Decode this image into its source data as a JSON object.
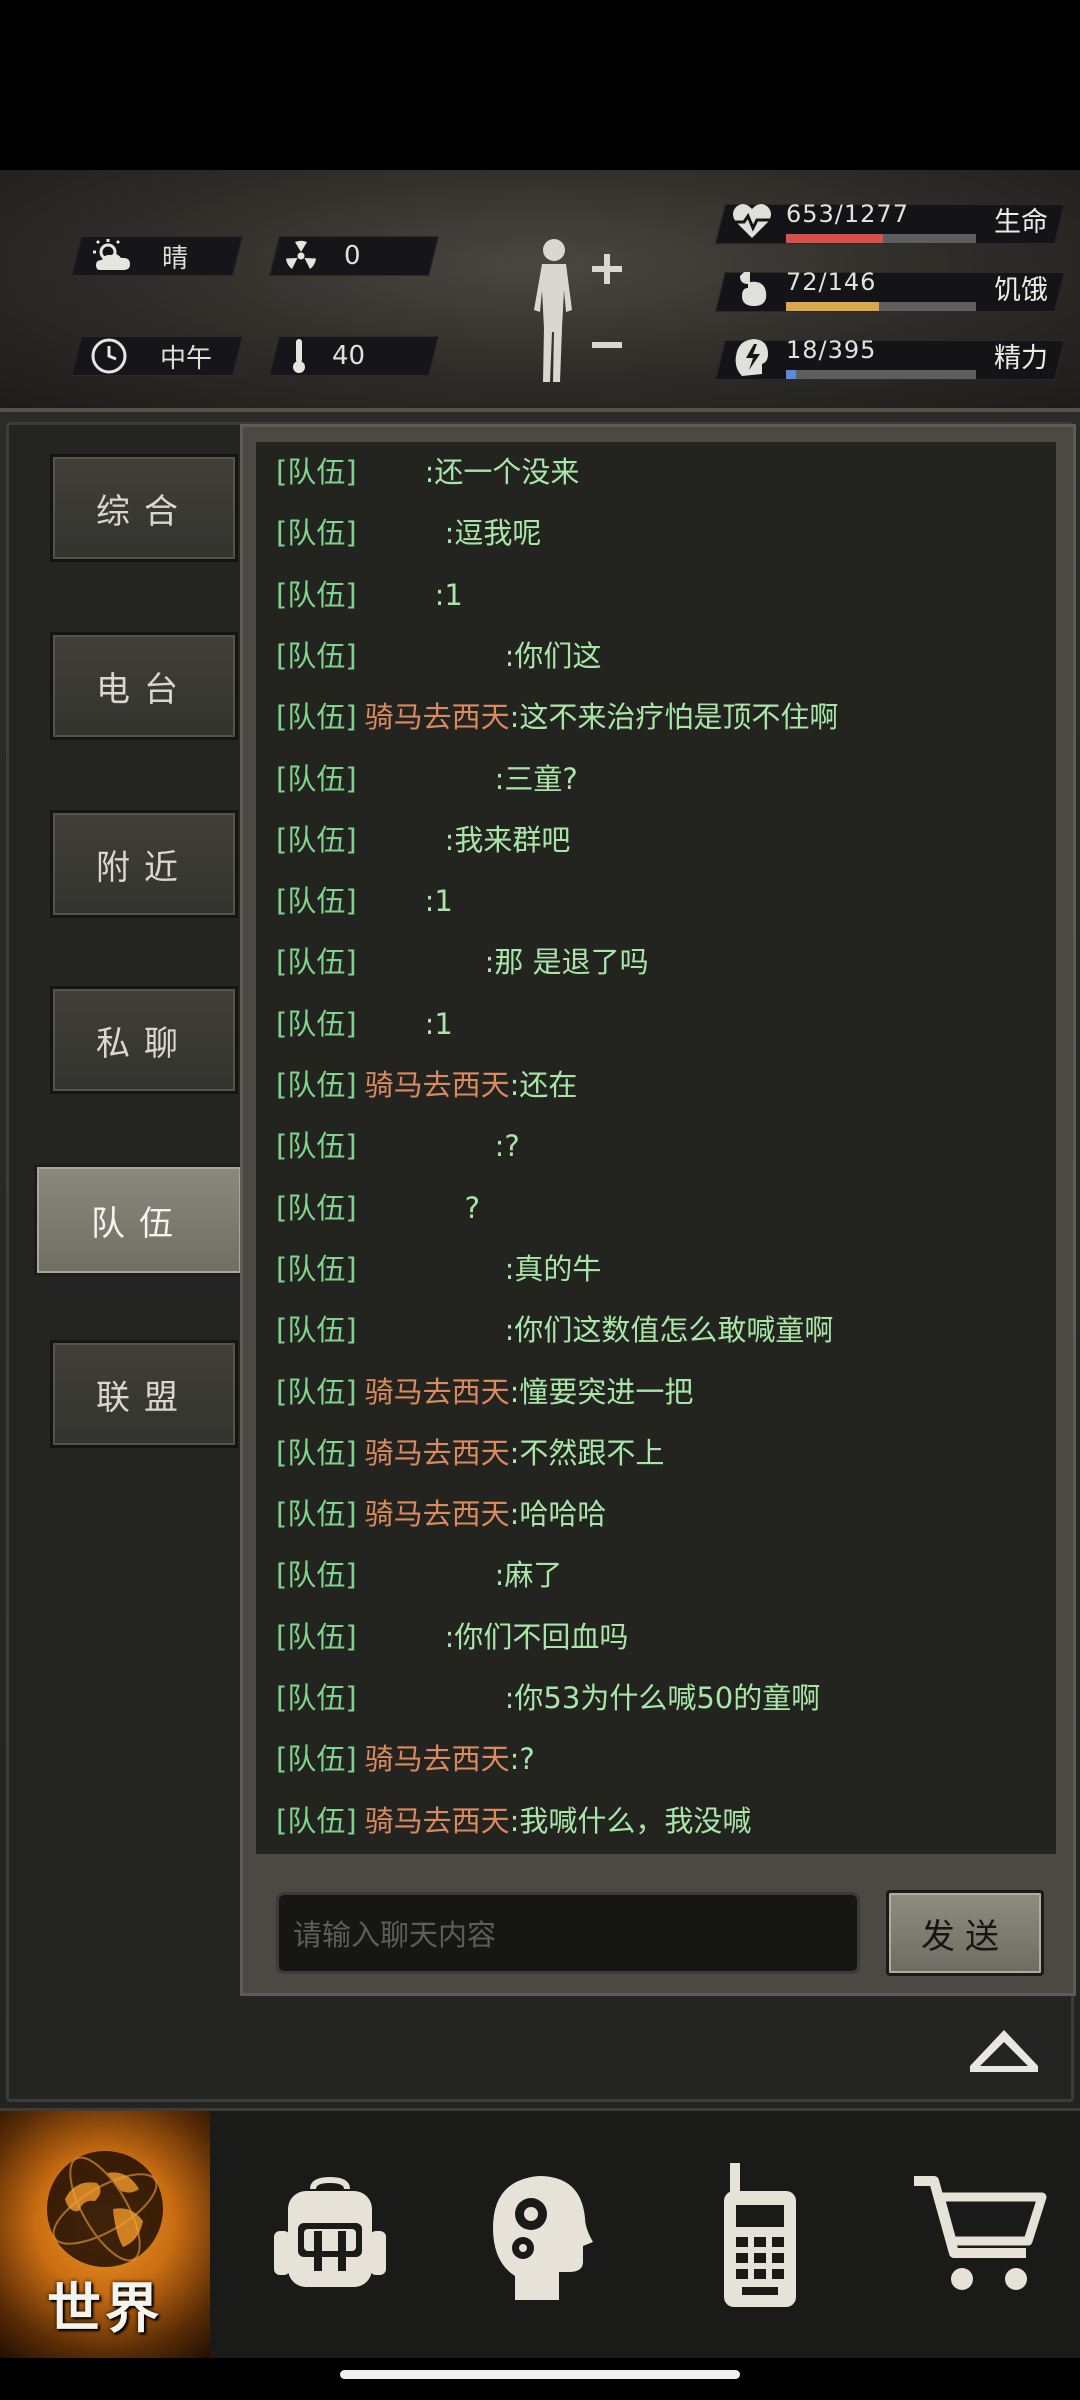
{
  "hud": {
    "weather": "晴",
    "radiation": "0",
    "time_of_day": "中午",
    "temperature": "40",
    "stats": {
      "hp": {
        "value": "653/1277",
        "label": "生命",
        "fraction": 0.51,
        "color": "#d8504a"
      },
      "hunger": {
        "value": "72/146",
        "label": "饥饿",
        "fraction": 0.49,
        "color": "#d8a84a"
      },
      "energy": {
        "value": "18/395",
        "label": "精力",
        "fraction": 0.05,
        "color": "#5a8ad8"
      }
    }
  },
  "tabs": [
    "综合",
    "电台",
    "附近",
    "私聊",
    "队伍",
    "联盟"
  ],
  "active_tab": "队伍",
  "chat": {
    "channel_tag": "[队伍]",
    "messages": [
      {
        "name": "",
        "text": ":还一个没来"
      },
      {
        "name": "",
        "text": ":逗我呢"
      },
      {
        "name": "",
        "text": ":1"
      },
      {
        "name": "",
        "text": ":你们这"
      },
      {
        "name": "骑马去西天",
        "text": ":这不来治疗怕是顶不住啊"
      },
      {
        "name": "",
        "text": ":三童?"
      },
      {
        "name": "",
        "text": ":我来群吧"
      },
      {
        "name": "",
        "text": ":1"
      },
      {
        "name": "",
        "text": ":那 是退了吗"
      },
      {
        "name": "",
        "text": ":1"
      },
      {
        "name": "骑马去西天",
        "text": ":还在"
      },
      {
        "name": "",
        "text": ":?"
      },
      {
        "name": "",
        "text": "?"
      },
      {
        "name": "",
        "text": ":真的牛"
      },
      {
        "name": "",
        "text": ":你们这数值怎么敢喊童啊"
      },
      {
        "name": "骑马去西天",
        "text": ":憧要突进一把"
      },
      {
        "name": "骑马去西天",
        "text": ":不然跟不上"
      },
      {
        "name": "骑马去西天",
        "text": ":哈哈哈"
      },
      {
        "name": "",
        "text": ":麻了"
      },
      {
        "name": "",
        "text": ":你们不回血吗"
      },
      {
        "name": "",
        "text": ":你53为什么喊50的童啊"
      },
      {
        "name": "骑马去西天",
        "text": ":?"
      },
      {
        "name": "骑马去西天",
        "text": ":我喊什么，我没喊"
      }
    ],
    "input_placeholder": "请输入聊天内容",
    "send_label": "发送"
  },
  "nav": {
    "world_label": "世界",
    "items": [
      "world-icon",
      "backpack-icon",
      "skills-head-icon",
      "walkie-talkie-icon",
      "shop-cart-icon"
    ]
  }
}
